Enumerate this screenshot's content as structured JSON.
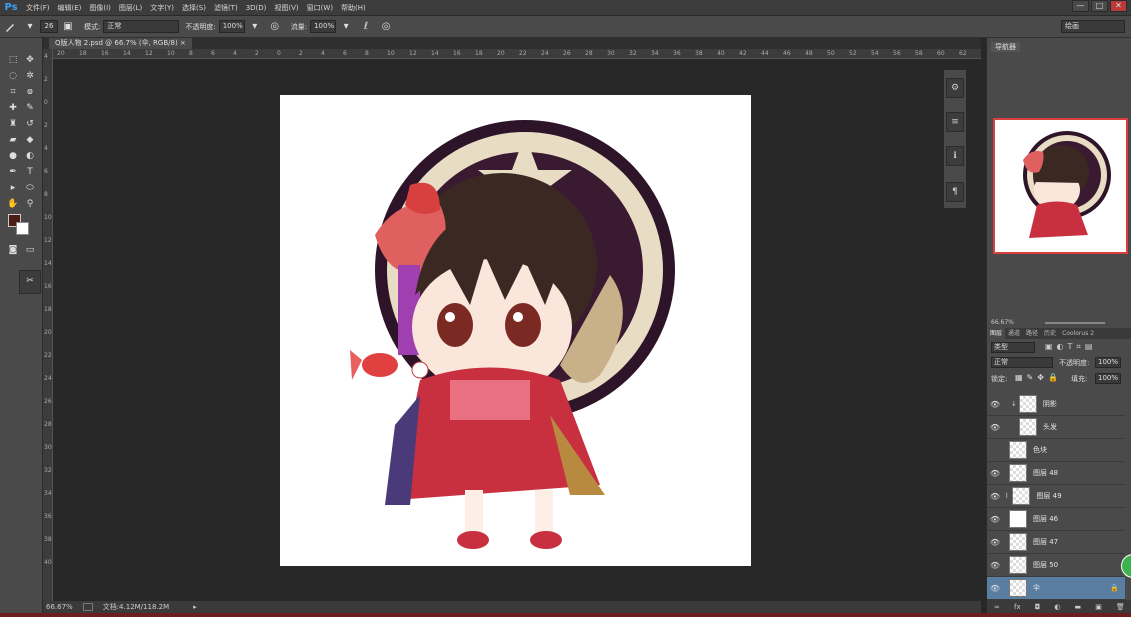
{
  "menubar": {
    "logo": "Ps",
    "items": [
      "文件(F)",
      "编辑(E)",
      "图像(I)",
      "图层(L)",
      "文字(Y)",
      "选择(S)",
      "滤镜(T)",
      "3D(D)",
      "视图(V)",
      "窗口(W)",
      "帮助(H)"
    ],
    "min": "—",
    "max": "□",
    "close": "✕"
  },
  "options": {
    "brush_size": "26",
    "mode_label": "模式:",
    "mode_value": "正常",
    "opacity_label": "不透明度:",
    "opacity_value": "100%",
    "flow_label": "流量:",
    "flow_value": "100%",
    "workspace": "绘画"
  },
  "document": {
    "tab_title": "Q版人物 2.psd @ 66.7% (伞, RGB/8)",
    "tab_close": "×",
    "zoom": "66.67%",
    "doc_info": "文档:4.12M/118.2M"
  },
  "rulers": {
    "top": [
      "20",
      "18",
      "16",
      "14",
      "12",
      "10",
      "8",
      "6",
      "4",
      "2",
      "0",
      "2",
      "4",
      "6",
      "8",
      "10",
      "12",
      "14",
      "16",
      "18",
      "20",
      "22",
      "24",
      "26",
      "28",
      "30",
      "32",
      "34",
      "36",
      "38",
      "40",
      "42",
      "44",
      "46",
      "48",
      "50",
      "52",
      "54",
      "56",
      "58",
      "60",
      "62"
    ],
    "left": [
      "4",
      "2",
      "0",
      "2",
      "4",
      "6",
      "8",
      "10",
      "12",
      "14",
      "16",
      "18",
      "20",
      "22",
      "24",
      "26",
      "28",
      "30",
      "32",
      "34",
      "36",
      "38",
      "40"
    ]
  },
  "navigator": {
    "tab": "导航器",
    "zoom": "66.67%"
  },
  "layers_panel": {
    "tabs": [
      "图层",
      "通道",
      "路径",
      "历史",
      "Coolorus 2"
    ],
    "filter": "类型",
    "blend_mode": "正常",
    "opacity_label": "不透明度:",
    "opacity_value": "100%",
    "lock_label": "锁定:",
    "fill_label": "填充:",
    "fill_value": "100%",
    "layers": [
      {
        "name": "阴影",
        "visible": true,
        "selected": false
      },
      {
        "name": "头发",
        "visible": true,
        "selected": false
      },
      {
        "name": "色块",
        "visible": false,
        "selected": false
      },
      {
        "name": "图层 48",
        "visible": true,
        "selected": false
      },
      {
        "name": "图层 49",
        "visible": true,
        "selected": false
      },
      {
        "name": "图层 46",
        "visible": true,
        "selected": false
      },
      {
        "name": "图层 47",
        "visible": true,
        "selected": false
      },
      {
        "name": "图层 50",
        "visible": true,
        "selected": false
      },
      {
        "name": "伞",
        "visible": true,
        "selected": true
      }
    ],
    "footer_icons": [
      "link-icon",
      "fx-icon",
      "mask-icon",
      "adjustment-icon",
      "folder-icon",
      "new-layer-icon",
      "trash-icon"
    ]
  },
  "colors": {
    "foreground": "#4a1e14",
    "background": "#ffffff",
    "selection": "#5a7da2",
    "accent": "#3ea0f0"
  }
}
